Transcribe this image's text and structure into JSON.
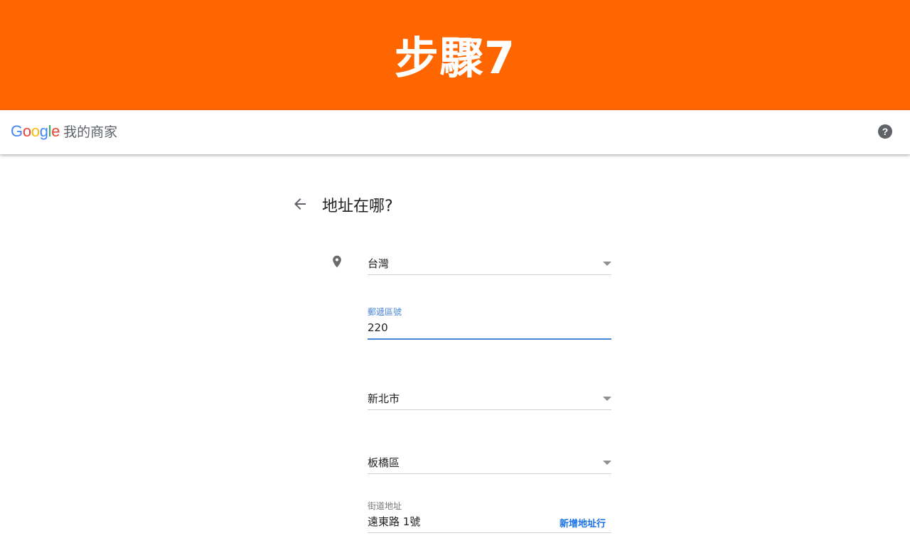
{
  "banner": {
    "title": "步驟7"
  },
  "header": {
    "logo_letters": [
      {
        "char": "G",
        "color": "#4285F4"
      },
      {
        "char": "o",
        "color": "#EA4335"
      },
      {
        "char": "o",
        "color": "#FBBC05"
      },
      {
        "char": "g",
        "color": "#4285F4"
      },
      {
        "char": "l",
        "color": "#34A853"
      },
      {
        "char": "e",
        "color": "#EA4335"
      }
    ],
    "product_name": "我的商家",
    "help_icon": "help-circle-icon",
    "help_symbol": "?"
  },
  "page": {
    "back_icon": "arrow-back-icon",
    "title": "地址在哪?"
  },
  "form": {
    "location_icon": "map-pin-icon",
    "country": {
      "value": "台灣"
    },
    "postal_code": {
      "label": "郵遞區號",
      "value": "220"
    },
    "city": {
      "value": "新北市"
    },
    "district": {
      "value": "板橋區"
    },
    "street": {
      "label": "街道地址",
      "value": "遠東路 1號",
      "add_line_label": "新增地址行"
    }
  },
  "colors": {
    "banner": "#ff6600",
    "accent": "#4a86d8",
    "link": "#1a73e8"
  }
}
